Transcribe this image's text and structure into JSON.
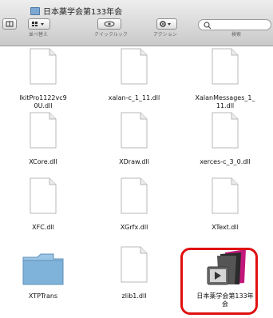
{
  "window": {
    "title": "日本薬学会第133年会"
  },
  "toolbar": {
    "view_label": "表示",
    "arrange_label": "並べ替え",
    "quicklook_label": "クイックルック",
    "action_label": "アクション",
    "search_label": "検索",
    "search_placeholder": ""
  },
  "files": [
    {
      "name": "lkitPro1122vc9\n0U.dll",
      "type": "dll"
    },
    {
      "name": "xalan-c_1_11.dll",
      "type": "dll"
    },
    {
      "name": "XalanMessages_1_\n11.dll",
      "type": "dll"
    },
    {
      "name": "XCore.dll",
      "type": "dll"
    },
    {
      "name": "XDraw.dll",
      "type": "dll"
    },
    {
      "name": "xerces-c_3_0.dll",
      "type": "dll"
    },
    {
      "name": "XFC.dll",
      "type": "dll"
    },
    {
      "name": "XGrfx.dll",
      "type": "dll"
    },
    {
      "name": "XText.dll",
      "type": "dll"
    },
    {
      "name": "XTPTrans",
      "type": "folder"
    },
    {
      "name": "zlib1.dll",
      "type": "dll"
    },
    {
      "name": "日本薬学会第133年\n会",
      "type": "app"
    }
  ],
  "colors": {
    "highlight": "#e01010",
    "folder": "#7fb3da"
  }
}
